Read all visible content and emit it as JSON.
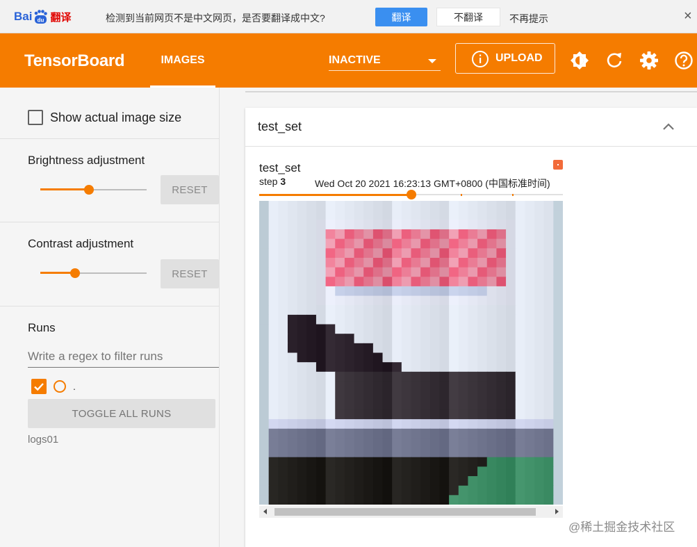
{
  "translate_bar": {
    "logo_text": "Bai",
    "logo_du": "du",
    "logo_suffix": "翻译",
    "message": "检测到当前网页不是中文网页，是否要翻译成中文?",
    "translate_label": "翻译",
    "dont_translate_label": "不翻译",
    "no_remind_label": "不再提示",
    "close_glyph": "×"
  },
  "header": {
    "brand": "TensorBoard",
    "active_tab": "IMAGES",
    "plugin_select": "INACTIVE",
    "upload_label": "UPLOAD",
    "accent_color": "#f57c00"
  },
  "sidebar": {
    "show_actual_size_label": "Show actual image size",
    "show_actual_size_checked": false,
    "brightness": {
      "title": "Brightness adjustment",
      "reset_label": "RESET",
      "value_fraction": 0.46
    },
    "contrast": {
      "title": "Contrast adjustment",
      "reset_label": "RESET",
      "value_fraction": 0.33
    },
    "runs": {
      "title": "Runs",
      "filter_placeholder": "Write a regex to filter runs",
      "run_checked": true,
      "run_dot": ".",
      "toggle_all_label": "TOGGLE ALL RUNS",
      "run_name": "logs01"
    }
  },
  "main": {
    "card_title": "test_set",
    "image_card": {
      "tag": "test_set",
      "step_label": "step",
      "step_value": "3",
      "timestamp": "Wed Oct 20 2021 16:23:13 GMT+0800 (中国标准时间)",
      "step_position_fraction": 0.5
    }
  },
  "watermark": "@稀土掘金技术社区"
}
